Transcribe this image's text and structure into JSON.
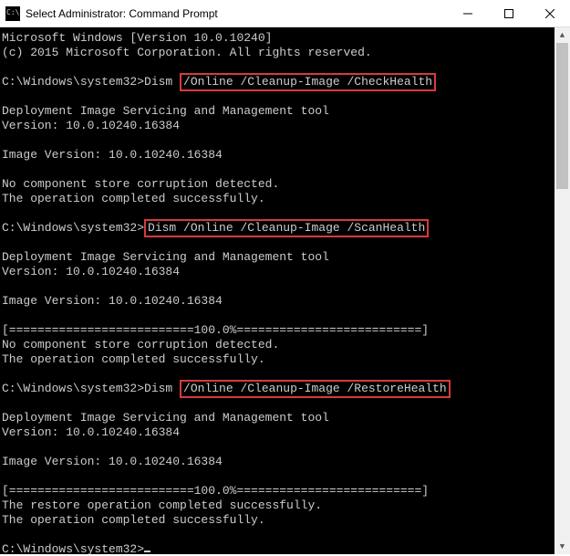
{
  "window": {
    "title": "Select Administrator: Command Prompt"
  },
  "terminal": {
    "line1": "Microsoft Windows [Version 10.0.10240]",
    "line2": "(c) 2015 Microsoft Corporation. All rights reserved.",
    "prompt1_pre": "C:\\Windows\\system32>Dism ",
    "prompt1_hl": "/Online /Cleanup-Image /CheckHealth",
    "dism_tool": "Deployment Image Servicing and Management tool",
    "dism_ver": "Version: 10.0.10240.16384",
    "img_ver": "Image Version: 10.0.10240.16384",
    "no_corrupt": "No component store corruption detected.",
    "op_success": "The operation completed successfully.",
    "prompt2_pre": "C:\\Windows\\system32>",
    "prompt2_hl": "Dism /Online /Cleanup-Image /ScanHealth",
    "progress": "[==========================100.0%==========================]",
    "prompt3_pre": "C:\\Windows\\system32>Dism ",
    "prompt3_hl": "/Online /Cleanup-Image /RestoreHealth",
    "restore_success": "The restore operation completed successfully.",
    "final_prompt": "C:\\Windows\\system32>"
  }
}
